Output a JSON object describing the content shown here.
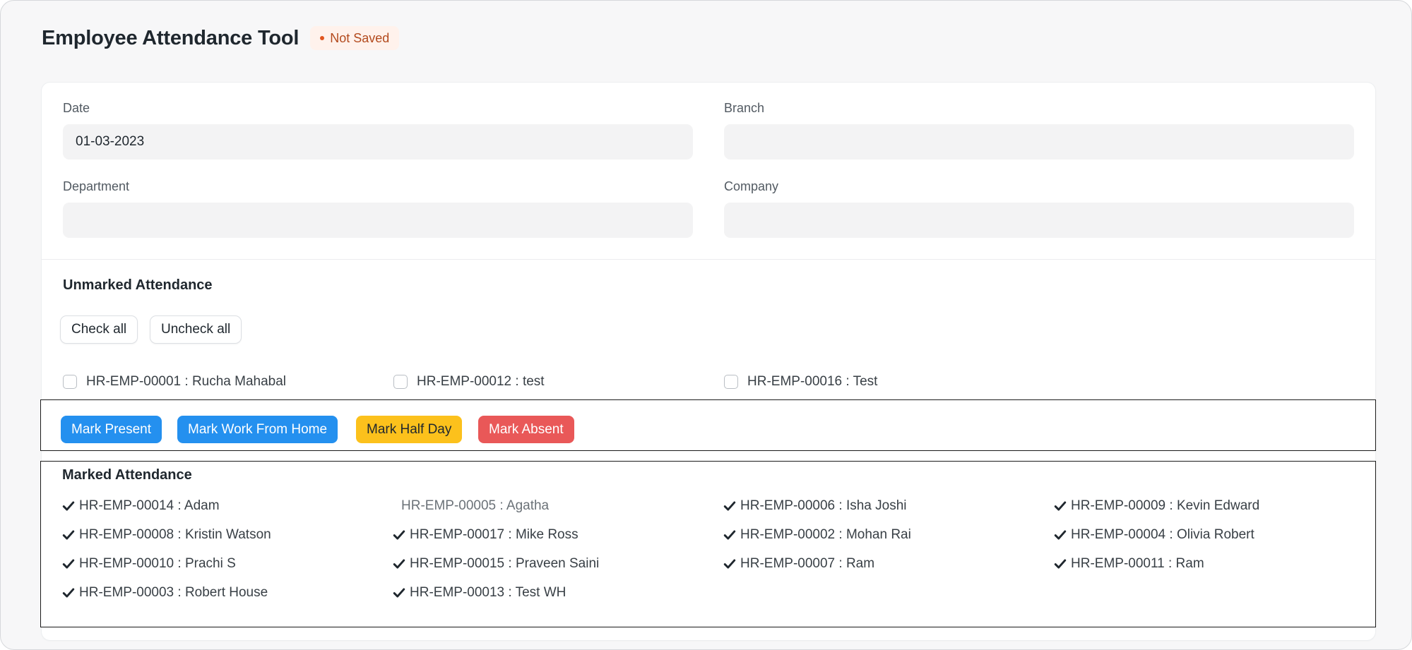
{
  "header": {
    "title": "Employee Attendance Tool",
    "status": "Not Saved"
  },
  "form": {
    "date": {
      "label": "Date",
      "value": "01-03-2023"
    },
    "branch": {
      "label": "Branch",
      "value": ""
    },
    "department": {
      "label": "Department",
      "value": ""
    },
    "company": {
      "label": "Company",
      "value": ""
    }
  },
  "unmarked": {
    "title": "Unmarked Attendance",
    "check_all": "Check all",
    "uncheck_all": "Uncheck all",
    "employees": [
      "HR-EMP-00001 : Rucha Mahabal",
      "HR-EMP-00012 : test",
      "HR-EMP-00016 : Test"
    ]
  },
  "actions": {
    "mark_present": "Mark Present",
    "mark_wfh": "Mark Work From Home",
    "mark_half_day": "Mark Half Day",
    "mark_absent": "Mark Absent"
  },
  "marked": {
    "title": "Marked Attendance",
    "employees": [
      {
        "label": "HR-EMP-00014 : Adam",
        "checked": true
      },
      {
        "label": "HR-EMP-00005 : Agatha",
        "checked": false
      },
      {
        "label": "HR-EMP-00006 : Isha Joshi",
        "checked": true
      },
      {
        "label": "HR-EMP-00009 : Kevin Edward",
        "checked": true
      },
      {
        "label": "HR-EMP-00008 : Kristin Watson",
        "checked": true
      },
      {
        "label": "HR-EMP-00017 : Mike Ross",
        "checked": true
      },
      {
        "label": "HR-EMP-00002 : Mohan Rai",
        "checked": true
      },
      {
        "label": "HR-EMP-00004 : Olivia Robert",
        "checked": true
      },
      {
        "label": "HR-EMP-00010 : Prachi S",
        "checked": true
      },
      {
        "label": "HR-EMP-00015 : Praveen Saini",
        "checked": true
      },
      {
        "label": "HR-EMP-00007 : Ram",
        "checked": true
      },
      {
        "label": "HR-EMP-00011 : Ram",
        "checked": true
      },
      {
        "label": "HR-EMP-00003 : Robert House",
        "checked": true
      },
      {
        "label": "HR-EMP-00013 : Test WH",
        "checked": true
      }
    ]
  },
  "colors": {
    "primary": "#2490ef",
    "warning": "#fcc11c",
    "danger": "#e95858",
    "status_text": "#b34a1d",
    "status_bg": "#fff2ec"
  },
  "icons": {
    "check": "check-icon",
    "status_dot": "status-dot-icon"
  }
}
